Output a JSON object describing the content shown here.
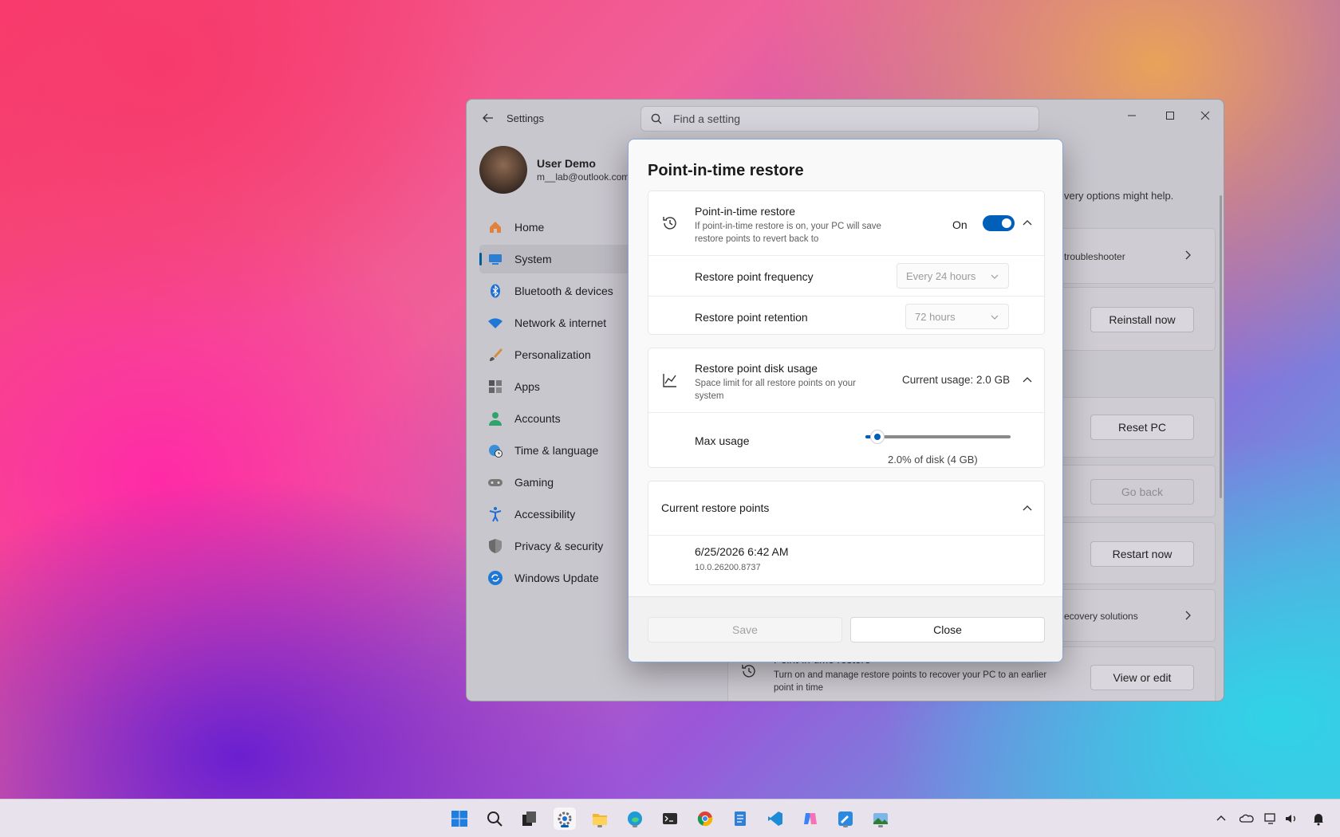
{
  "settings_window": {
    "title": "Settings",
    "search_placeholder": "Find a setting",
    "user": {
      "name": "User Demo",
      "email": "m__lab@outlook.com"
    },
    "nav": [
      {
        "label": "Home",
        "icon": "home-icon"
      },
      {
        "label": "System",
        "icon": "system-icon",
        "active": true
      },
      {
        "label": "Bluetooth & devices",
        "icon": "bluetooth-icon"
      },
      {
        "label": "Network & internet",
        "icon": "wifi-icon"
      },
      {
        "label": "Personalization",
        "icon": "brush-icon"
      },
      {
        "label": "Apps",
        "icon": "apps-icon"
      },
      {
        "label": "Accounts",
        "icon": "accounts-icon"
      },
      {
        "label": "Time & language",
        "icon": "globe-clock-icon"
      },
      {
        "label": "Gaming",
        "icon": "gamepad-icon"
      },
      {
        "label": "Accessibility",
        "icon": "accessibility-icon"
      },
      {
        "label": "Privacy & security",
        "icon": "shield-icon"
      },
      {
        "label": "Windows Update",
        "icon": "update-icon"
      }
    ],
    "background": {
      "recovery_hint": "very options might help.",
      "troubleshooter": "troubleshooter",
      "reinstall_btn": "Reinstall now",
      "reset_btn": "Reset PC",
      "goback_btn": "Go back",
      "restart_btn": "Restart now",
      "recovery_solutions": "ecovery solutions",
      "pitr_title": "Point-in-time restore",
      "pitr_desc": "Turn on and manage restore points to recover your PC to an earlier point in time",
      "view_edit_btn": "View or edit"
    }
  },
  "dialog": {
    "title": "Point-in-time restore",
    "pitr": {
      "title": "Point-in-time restore",
      "desc": "If point-in-time restore is on, your PC will save restore points to revert back to",
      "toggle_label": "On",
      "toggle_on": true
    },
    "frequency": {
      "label": "Restore point frequency",
      "value": "Every 24 hours"
    },
    "retention": {
      "label": "Restore point retention",
      "value": "72 hours"
    },
    "disk_usage": {
      "title": "Restore point disk usage",
      "desc": "Space limit for all restore points on your system",
      "current": "Current usage: 2.0 GB"
    },
    "max_usage": {
      "label": "Max usage",
      "caption": "2.0% of disk (4 GB)",
      "level_percent": 8
    },
    "restore_points": {
      "title": "Current restore points",
      "items": [
        {
          "date": "6/25/2026 6:42 AM",
          "build": "10.0.26200.8737"
        }
      ]
    },
    "save_label": "Save",
    "close_label": "Close"
  },
  "colors": {
    "accent": "#005fb8"
  },
  "taskbar": {
    "icons": [
      "start-icon",
      "search-icon",
      "task-view-icon",
      "settings-icon",
      "file-explorer-icon",
      "edge-icon",
      "terminal-icon",
      "chrome-icon",
      "notepad-icon",
      "vscode-icon",
      "copilot-icon",
      "paint-icon",
      "photos-icon"
    ]
  }
}
